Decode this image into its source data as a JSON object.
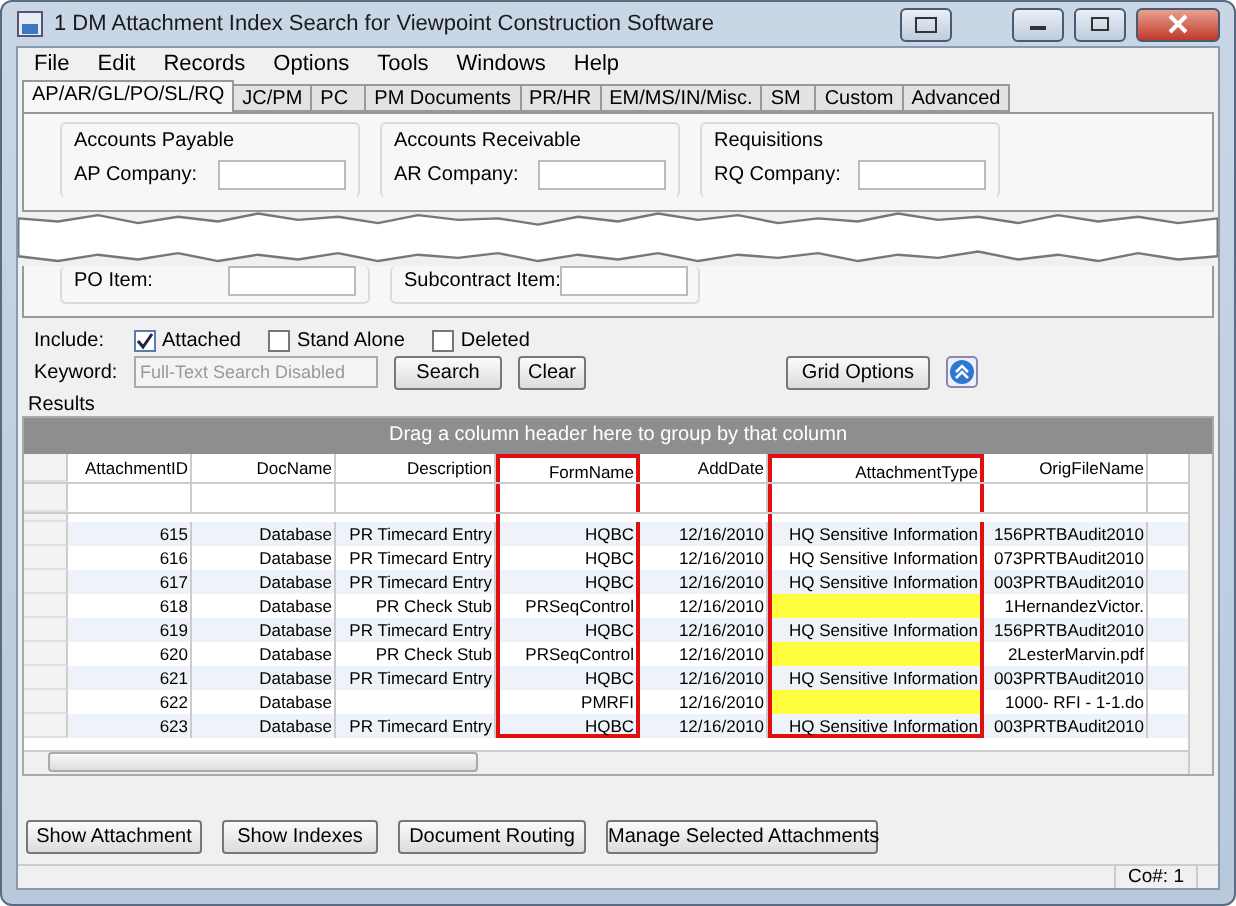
{
  "window": {
    "title": "1 DM Attachment Index Search for Viewpoint Construction Software"
  },
  "menu": [
    "File",
    "Edit",
    "Records",
    "Options",
    "Tools",
    "Windows",
    "Help"
  ],
  "tabs": [
    {
      "label": "AP/AR/GL/PO/SL/RQ",
      "selected": true
    },
    {
      "label": "JC/PM",
      "selected": false
    },
    {
      "label": "PC",
      "selected": false
    },
    {
      "label": "PM Documents",
      "selected": false
    },
    {
      "label": "PR/HR",
      "selected": false
    },
    {
      "label": "EM/MS/IN/Misc.",
      "selected": false
    },
    {
      "label": "SM",
      "selected": false
    },
    {
      "label": "Custom",
      "selected": false
    },
    {
      "label": "Advanced",
      "selected": false
    }
  ],
  "groups_top": [
    {
      "title": "Accounts Payable",
      "field": "AP Company:"
    },
    {
      "title": "Accounts Receivable",
      "field": "AR Company:"
    },
    {
      "title": "Requisitions",
      "field": "RQ Company:"
    }
  ],
  "groups_bottom": [
    {
      "field": "PO Item:"
    },
    {
      "field": "Subcontract Item:"
    }
  ],
  "include": {
    "label": "Include:",
    "options": [
      {
        "label": "Attached",
        "checked": true
      },
      {
        "label": "Stand Alone",
        "checked": false
      },
      {
        "label": "Deleted",
        "checked": false
      }
    ]
  },
  "keyword": {
    "label": "Keyword:",
    "placeholder": "Full-Text Search Disabled",
    "buttons": [
      "Search",
      "Clear"
    ],
    "grid_options": "Grid Options"
  },
  "results": {
    "title": "Results",
    "group_hint": "Drag a column header here to group by that column",
    "columns": [
      {
        "label": "AttachmentID",
        "highlighted": false
      },
      {
        "label": "DocName",
        "highlighted": false
      },
      {
        "label": "Description",
        "highlighted": false
      },
      {
        "label": "FormName",
        "highlighted": true
      },
      {
        "label": "AddDate",
        "highlighted": false
      },
      {
        "label": "AttachmentType",
        "highlighted": true
      },
      {
        "label": "OrigFileName",
        "highlighted": false
      }
    ],
    "rows": [
      {
        "cells": [
          "615",
          "Database",
          "PR Timecard Entry",
          "HQBC",
          "12/16/2010",
          "HQ Sensitive Information",
          "156PRTBAudit2010"
        ],
        "missing_type": false
      },
      {
        "cells": [
          "616",
          "Database",
          "PR Timecard Entry",
          "HQBC",
          "12/16/2010",
          "HQ Sensitive Information",
          "073PRTBAudit2010"
        ],
        "missing_type": false
      },
      {
        "cells": [
          "617",
          "Database",
          "PR Timecard Entry",
          "HQBC",
          "12/16/2010",
          "HQ Sensitive Information",
          "003PRTBAudit2010"
        ],
        "missing_type": false
      },
      {
        "cells": [
          "618",
          "Database",
          "PR Check Stub",
          "PRSeqControl",
          "12/16/2010",
          "",
          "1HernandezVictor."
        ],
        "missing_type": true
      },
      {
        "cells": [
          "619",
          "Database",
          "PR Timecard Entry",
          "HQBC",
          "12/16/2010",
          "HQ Sensitive Information",
          "156PRTBAudit2010"
        ],
        "missing_type": false
      },
      {
        "cells": [
          "620",
          "Database",
          "PR Check Stub",
          "PRSeqControl",
          "12/16/2010",
          "",
          "2LesterMarvin.pdf"
        ],
        "missing_type": true
      },
      {
        "cells": [
          "621",
          "Database",
          "PR Timecard Entry",
          "HQBC",
          "12/16/2010",
          "HQ Sensitive Information",
          "003PRTBAudit2010"
        ],
        "missing_type": false
      },
      {
        "cells": [
          "622",
          "Database",
          "",
          "PMRFI",
          "12/16/2010",
          "",
          "1000- RFI - 1-1.do"
        ],
        "missing_type": true
      },
      {
        "cells": [
          "623",
          "Database",
          "PR Timecard Entry",
          "HQBC",
          "12/16/2010",
          "HQ Sensitive Information",
          "003PRTBAudit2010"
        ],
        "missing_type": false
      }
    ]
  },
  "actions": [
    "Show Attachment",
    "Show Indexes",
    "Document Routing",
    "Manage Selected Attachments"
  ],
  "status_bar": {
    "company": "Co#: 1"
  }
}
